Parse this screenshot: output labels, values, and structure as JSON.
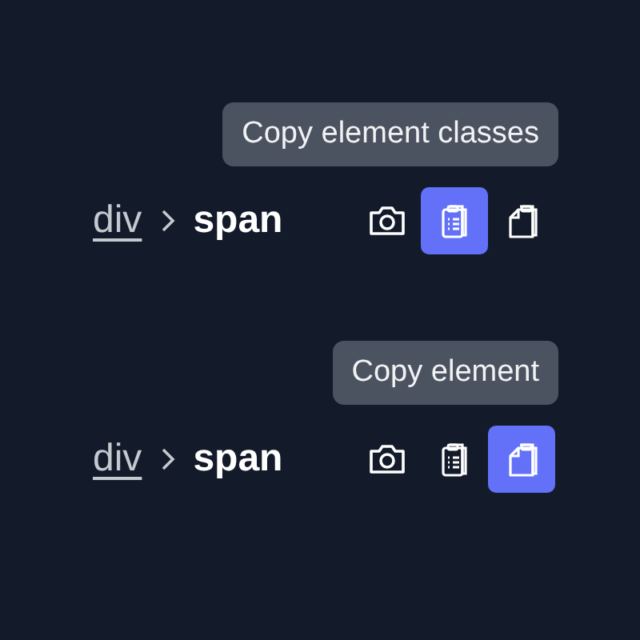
{
  "panels": [
    {
      "tooltip": "Copy element classes",
      "breadcrumb": [
        {
          "text": "div",
          "kind": "link"
        },
        {
          "text": "span",
          "kind": "current"
        }
      ],
      "actions": [
        {
          "kind": "camera",
          "selected": false
        },
        {
          "kind": "list-clipboard",
          "selected": true
        },
        {
          "kind": "copy-clipboard",
          "selected": false
        }
      ]
    },
    {
      "tooltip": "Copy element",
      "breadcrumb": [
        {
          "text": "div",
          "kind": "link"
        },
        {
          "text": "span",
          "kind": "current"
        }
      ],
      "actions": [
        {
          "kind": "camera",
          "selected": false
        },
        {
          "kind": "list-clipboard",
          "selected": false
        },
        {
          "kind": "copy-clipboard",
          "selected": true
        }
      ]
    }
  ]
}
